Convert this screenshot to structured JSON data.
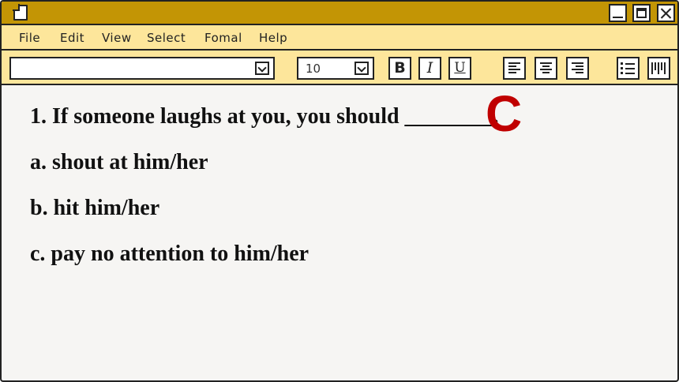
{
  "menu": [
    "File",
    "Edit",
    "View",
    "Select",
    "Fomal",
    "Help"
  ],
  "toolbar": {
    "font_select_value": "",
    "font_size_value": "10",
    "bold_label": "B",
    "italic_label": "I",
    "underline_label": "U"
  },
  "document": {
    "question": "1. If someone laughs at you, you should ________.",
    "answer": "C",
    "options": [
      "a. shout at him/her",
      "b. hit him/her",
      "c. pay no attention to him/her"
    ]
  },
  "colors": {
    "titlebar": "#c39505",
    "menubar": "#fde69b",
    "answer": "#c00000",
    "page": "#f6f5f3"
  },
  "icons": [
    "document-icon",
    "minimize-icon",
    "maximize-icon",
    "close-icon",
    "chevron-down-icon",
    "align-left-icon",
    "align-center-icon",
    "align-right-icon",
    "list-icon",
    "columns-icon"
  ]
}
